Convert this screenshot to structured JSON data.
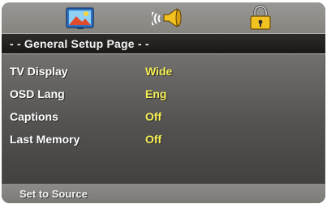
{
  "icons": {
    "tab1": "general-setup-icon",
    "tab2": "audio-speaker-icon",
    "tab3": "lock-icon"
  },
  "title": "- - General Setup Page - -",
  "settings": [
    {
      "label": "TV Display",
      "value": "Wide"
    },
    {
      "label": "OSD Lang",
      "value": "Eng"
    },
    {
      "label": "Captions",
      "value": "Off"
    },
    {
      "label": "Last Memory",
      "value": "Off"
    }
  ],
  "footer": "Set to Source",
  "colors": {
    "value_text": "#f5ef55",
    "label_text": "#ffffff",
    "title_bar": "#1f1e1d"
  }
}
